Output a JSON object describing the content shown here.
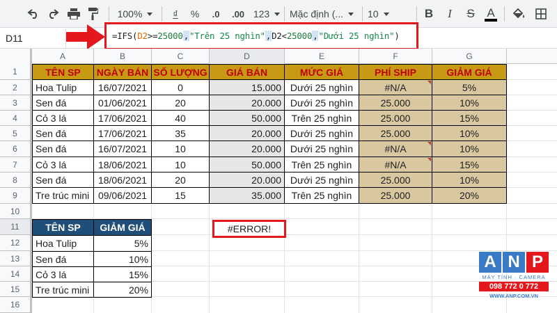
{
  "toolbar": {
    "zoom": "100%",
    "currency": "₫",
    "percent": "%",
    "dec_decrease": ".0",
    "dec_increase": ".00",
    "more_formats": "123",
    "font": "Mặc định (...",
    "font_size": "10",
    "bold": "B",
    "italic": "I",
    "strike": "S",
    "text_color": "A"
  },
  "formula_bar": {
    "cell_ref": "D11",
    "formula_parts": {
      "p1": "=IFS(",
      "p2": "D2",
      "p3": ">=",
      "p4": "25000",
      "p5": ",",
      "p6": "\"Trên 25 nghìn\"",
      "p7": ",",
      "p8": "D2<",
      "p9": "25000",
      "p10": ",",
      "p11": "\"Dưới 25 nghìn\"",
      "p12": ")"
    }
  },
  "columns": [
    "A",
    "B",
    "C",
    "D",
    "E",
    "F",
    "G"
  ],
  "rows": [
    "1",
    "2",
    "3",
    "4",
    "5",
    "6",
    "7",
    "8",
    "9",
    "10",
    "11",
    "12",
    "13",
    "14",
    "15",
    "16"
  ],
  "table": {
    "headers": [
      "TÊN SP",
      "NGÀY BÁN",
      "SỐ LƯỢNG",
      "GIÁ BÁN",
      "MỨC GIÁ",
      "PHÍ SHIP",
      "GIẢM GIÁ"
    ],
    "rows": [
      [
        "Hoa Tulip",
        "16/07/2021",
        "0",
        "15.000",
        "Dưới 25 nghìn",
        "#N/A",
        "5%"
      ],
      [
        "Sen đá",
        "01/06/2021",
        "20",
        "20.000",
        "Dưới 25 nghìn",
        "25.000",
        "10%"
      ],
      [
        "Cỏ 3 lá",
        "17/06/2021",
        "40",
        "50.000",
        "Trên 25 nghìn",
        "25.000",
        "15%"
      ],
      [
        "Sen đá",
        "17/06/2021",
        "35",
        "20.000",
        "Dưới 25 nghìn",
        "25.000",
        "10%"
      ],
      [
        "Sen đá",
        "16/07/2021",
        "10",
        "20.000",
        "Dưới 25 nghìn",
        "#N/A",
        "10%"
      ],
      [
        "Cỏ 3 lá",
        "18/06/2021",
        "10",
        "50.000",
        "Trên 25 nghìn",
        "#N/A",
        "15%"
      ],
      [
        "Sen đá",
        "18/06/2021",
        "20",
        "20.000",
        "Dưới 25 nghìn",
        "25.000",
        "10%"
      ],
      [
        "Tre trúc mini",
        "09/06/2021",
        "15",
        "35.000",
        "Trên 25 nghìn",
        "25.000",
        "20%"
      ]
    ]
  },
  "lookup": {
    "headers": [
      "TÊN SP",
      "GIẢM GIÁ"
    ],
    "rows": [
      [
        "Hoa Tulip",
        "5%"
      ],
      [
        "Sen đá",
        "10%"
      ],
      [
        "Cỏ 3 lá",
        "15%"
      ],
      [
        "Tre trúc mini",
        "20%"
      ]
    ]
  },
  "error_cell": "#ERROR!",
  "logo": {
    "letters": [
      "A",
      "N",
      "P"
    ],
    "tagline": "MÁY TÍNH · CAMERA",
    "phone": "098 772 0 772",
    "website": "WWW.ANP.COM.VN"
  },
  "colors": {
    "header_gold": "#c69a13",
    "header_text_red": "#c00000",
    "tan_fill": "#d9c79f",
    "blue_header": "#1f4e79",
    "highlight_red": "#e3171c",
    "logo_blue": "#3a7bc8"
  }
}
